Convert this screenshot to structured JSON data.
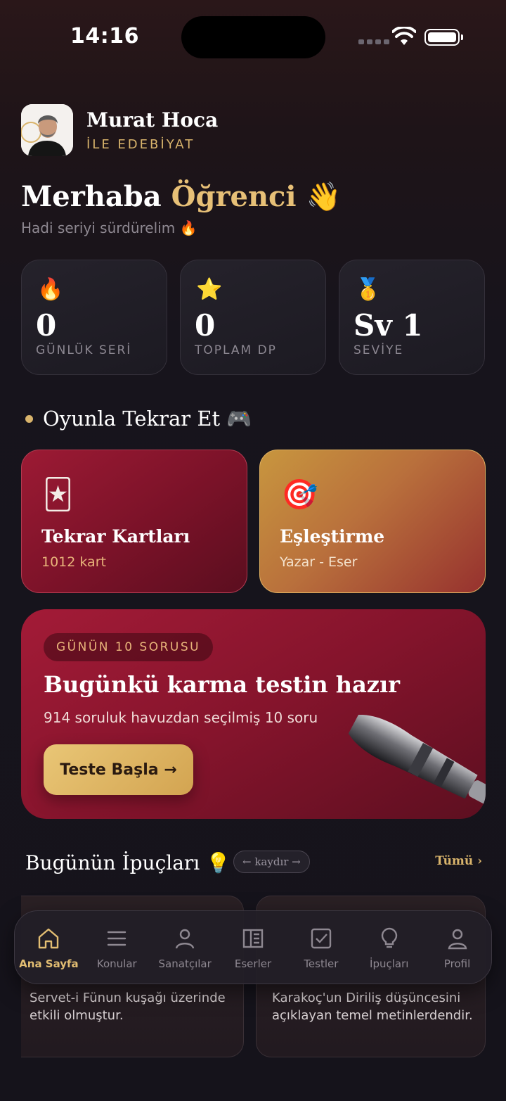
{
  "status": {
    "time": "14:16"
  },
  "brand": {
    "name": "Murat Hoca",
    "subtitle": "İLE EDEBİYAT"
  },
  "greeting": {
    "prefix": "Merhaba",
    "name": "Öğrenci",
    "emoji": "👋",
    "subtitle": "Hadi seriyi sürdürelim 🔥"
  },
  "stats": [
    {
      "icon": "🔥",
      "value": "0",
      "label": "GÜNLÜK SERİ"
    },
    {
      "icon": "⭐",
      "value": "0",
      "label": "TOPLAM DP"
    },
    {
      "icon": "🥇",
      "value": "Sv 1",
      "label": "SEVİYE"
    }
  ],
  "games_section": {
    "title": "Oyunla Tekrar Et 🎮"
  },
  "games": [
    {
      "icon": "🃏",
      "title": "Tekrar Kartları",
      "subtitle": "1012 kart"
    },
    {
      "icon": "🎯",
      "title": "Eşleştirme",
      "subtitle": "Yazar - Eser"
    }
  ],
  "quiz": {
    "badge": "GÜNÜN 10 SORUSU",
    "title": "Bugünkü karma testin hazır",
    "subtitle": "914 soruluk havuzdan seçilmiş 10 soru",
    "button": "Teste Başla →"
  },
  "tips": {
    "title": "Bugünün İpuçları 💡",
    "swipe_hint": "← kaydır →",
    "see_all": "Tümü ›",
    "cards": [
      {
        "text": "Servet-i Fünun kuşağı üzerinde etkili olmuştur."
      },
      {
        "text": "Karakoç'un Diriliş düşüncesini açıklayan temel metinlerdendir."
      }
    ]
  },
  "nav": {
    "items": [
      {
        "label": "Ana Sayfa",
        "icon": "home-icon",
        "active": true
      },
      {
        "label": "Konular",
        "icon": "list-icon"
      },
      {
        "label": "Sanatçılar",
        "icon": "person-icon"
      },
      {
        "label": "Eserler",
        "icon": "book-icon"
      },
      {
        "label": "Testler",
        "icon": "checkbox-icon"
      },
      {
        "label": "İpuçları",
        "icon": "lightbulb-icon"
      },
      {
        "label": "Profil",
        "icon": "profile-icon"
      }
    ]
  },
  "colors": {
    "accent_gold": "#d9b46c",
    "crimson": "#8a152e",
    "background": "#16141b"
  }
}
